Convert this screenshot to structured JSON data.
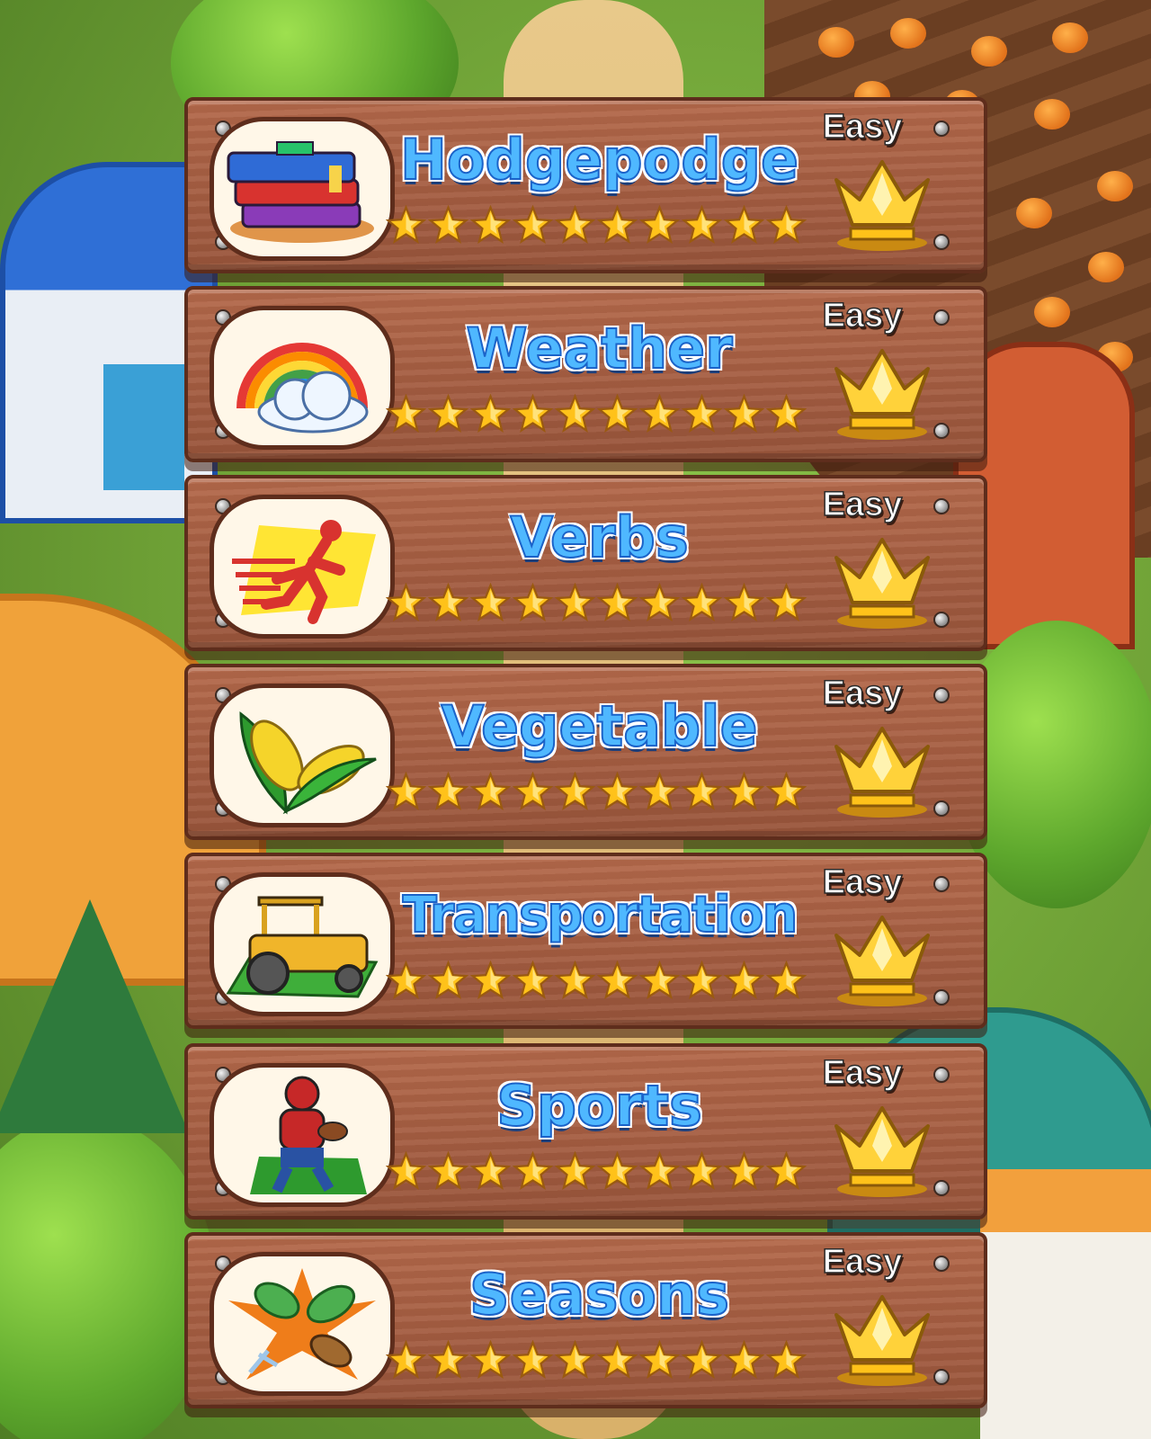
{
  "screen": {
    "name": "level-select"
  },
  "rows": [
    {
      "title": "Hodgepodge",
      "level": "Easy",
      "icon": "books-icon",
      "stars": 10,
      "max_stars": 10
    },
    {
      "title": "Weather",
      "level": "Easy",
      "icon": "rainbow-icon",
      "stars": 10,
      "max_stars": 10
    },
    {
      "title": "Verbs",
      "level": "Easy",
      "icon": "runner-icon",
      "stars": 10,
      "max_stars": 10
    },
    {
      "title": "Vegetable",
      "level": "Easy",
      "icon": "corn-icon",
      "stars": 10,
      "max_stars": 10
    },
    {
      "title": "Transportation",
      "level": "Easy",
      "icon": "tractor-icon",
      "stars": 10,
      "max_stars": 10
    },
    {
      "title": "Sports",
      "level": "Easy",
      "icon": "football-player-icon",
      "stars": 10,
      "max_stars": 10
    },
    {
      "title": "Seasons",
      "level": "Easy",
      "icon": "leaves-icon",
      "stars": 10,
      "max_stars": 10
    }
  ],
  "colors": {
    "title_fill": "#4fb8ff",
    "title_stroke": "#1b63c9",
    "star": "#ffc21a",
    "crown": "#ffd23a",
    "wood": "#a85e43"
  }
}
